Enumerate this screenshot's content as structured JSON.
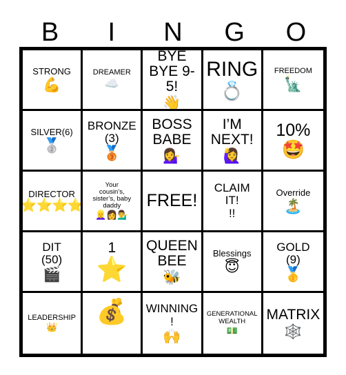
{
  "card": {
    "header_letters": [
      "B",
      "I",
      "N",
      "G",
      "O"
    ],
    "free_space_label": "FREE!",
    "rows": [
      [
        {
          "text": "STRONG",
          "emoji": "💪",
          "emoji_name": "flexed-biceps-emoji",
          "text_size": "t-sm",
          "emoji_size": "e-md"
        },
        {
          "text": "DREAMER",
          "emoji": "☁️",
          "emoji_name": "cloud-emoji",
          "text_size": "t-xs",
          "emoji_size": "e-sm"
        },
        {
          "text": "BYE\nBYE 9-5!",
          "emoji": "👋",
          "emoji_name": "waving-hand-emoji",
          "text_size": "t-lg",
          "emoji_size": "e-md"
        },
        {
          "text": "RING",
          "emoji": "💍",
          "emoji_name": "ring-emoji",
          "text_size": "t-xxl",
          "emoji_size": "e-lg"
        },
        {
          "text": "FREEDOM",
          "emoji": "🗽",
          "emoji_name": "statue-of-liberty-emoji",
          "text_size": "t-xs",
          "emoji_size": "e-md"
        }
      ],
      [
        {
          "text": "SILVER(6)",
          "emoji": "🥈",
          "emoji_name": "second-place-medal-emoji",
          "text_size": "t-sm",
          "emoji_size": "e-md"
        },
        {
          "text": "BRONZE\n(3)",
          "emoji": "🥉",
          "emoji_name": "third-place-medal-emoji",
          "text_size": "t-md",
          "emoji_size": "e-md"
        },
        {
          "text": "BOSS\nBABE",
          "emoji": "💁‍♀️",
          "emoji_name": "woman-tipping-hand-emoji",
          "text_size": "t-lg",
          "emoji_size": "e-md"
        },
        {
          "text": "I’M\nNEXT!",
          "emoji": "🙋‍♀️",
          "emoji_name": "woman-raising-hand-emoji",
          "text_size": "t-lg",
          "emoji_size": "e-md"
        },
        {
          "text": "10%",
          "emoji": "🤩",
          "emoji_name": "star-struck-face-emoji",
          "text_size": "t-xl",
          "emoji_size": "e-lg"
        }
      ],
      [
        {
          "text": "DIRECTOR",
          "stars": "⭐⭐⭐⭐",
          "emoji_name": "four-stars-rating",
          "text_size": "t-sm",
          "emoji_size": "e-md"
        },
        {
          "text": "Your\ncousin’s,\nsister’s, baby\ndaddy",
          "emoji": "👱‍♀️👩💁‍♂️",
          "emoji_name": "three-people-emoji",
          "text_size": "t-xxs",
          "emoji_size": "e-xs"
        },
        {
          "text": "FREE!",
          "emoji": "",
          "emoji_name": "free-space",
          "text_size": "t-xl",
          "emoji_size": "e-md"
        },
        {
          "text": "CLAIM\nIT!\n!!",
          "emoji": "",
          "emoji_name": "claim-it-text",
          "text_size": "t-md",
          "emoji_size": "e-md"
        },
        {
          "text": "Override",
          "emoji": "🏝️",
          "emoji_name": "desert-island-emoji",
          "text_size": "t-sm",
          "emoji_size": "e-md"
        }
      ],
      [
        {
          "text": "DIT\n(50)",
          "emoji": "🎬",
          "emoji_name": "clapper-board-emoji",
          "text_size": "t-md",
          "emoji_size": "e-md"
        },
        {
          "text": "1",
          "emoji": "⭐",
          "emoji_name": "star-emoji",
          "text_size": "t-lg",
          "emoji_size": "e-xl"
        },
        {
          "text": "QUEEN\nBEE",
          "emoji": "🐝",
          "emoji_name": "honeybee-emoji",
          "text_size": "t-lg",
          "emoji_size": "e-md"
        },
        {
          "text": "Blessings",
          "emoji": "😇",
          "emoji_name": "smiling-face-halo-emoji",
          "text_size": "t-sm",
          "emoji_size": "e-md"
        },
        {
          "text": "GOLD\n(9)",
          "emoji": "🥇",
          "emoji_name": "first-place-medal-emoji",
          "text_size": "t-md",
          "emoji_size": "e-md"
        }
      ],
      [
        {
          "text": "LEADERSHIP",
          "emoji": "👑",
          "emoji_name": "crown-emoji",
          "text_size": "t-xs",
          "emoji_size": "e-xs"
        },
        {
          "text": "",
          "emoji": "💰",
          "emoji_name": "money-bag-emoji",
          "text_size": "t-md",
          "emoji_size": "e-xl",
          "emoji_only": true
        },
        {
          "text": "WINNING!",
          "emoji": "🙌",
          "emoji_name": "raising-hands-emoji",
          "text_size": "t-md",
          "emoji_size": "e-md"
        },
        {
          "text": "GENERATIONAL\nWEALTH",
          "emoji": "💵",
          "emoji_name": "banknote-emoji",
          "text_size": "t-xxs",
          "emoji_size": "e-xs"
        },
        {
          "text": "MATRIX",
          "emoji": "🕸️",
          "emoji_name": "spider-web-emoji",
          "text_size": "t-lg",
          "emoji_size": "e-md"
        }
      ]
    ]
  }
}
